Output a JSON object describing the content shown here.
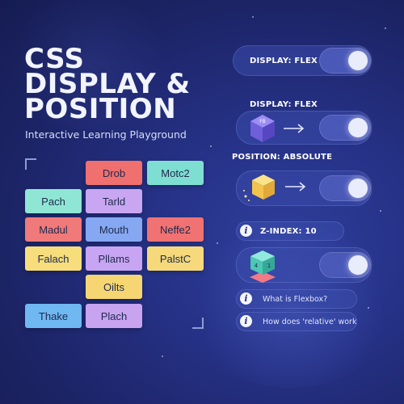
{
  "title_lines": [
    "CSS",
    "DISPLAY &",
    "POSITION"
  ],
  "subtitle": "Interactive Learning Playground",
  "blocks": [
    {
      "label": "Drob",
      "color": "#f06f6f"
    },
    {
      "label": "Motc2",
      "color": "#7fded2"
    },
    {
      "label": "Pach",
      "color": "#8fe6d4"
    },
    {
      "label": "Tarld",
      "color": "#c9a6f2"
    },
    {
      "label": "Madul",
      "color": "#f07a7a"
    },
    {
      "label": "Mouth",
      "color": "#86a8f2"
    },
    {
      "label": "Neffe2",
      "color": "#f07272"
    },
    {
      "label": "Falach",
      "color": "#f7dd7c"
    },
    {
      "label": "Pllams",
      "color": "#c7a5f2"
    },
    {
      "label": "PalstC",
      "color": "#f5d97a"
    },
    {
      "label": "Oilts",
      "color": "#f6d672"
    },
    {
      "label": "Thake",
      "color": "#6fb8f2"
    },
    {
      "label": "Plach",
      "color": "#c8a3f0"
    }
  ],
  "controls": {
    "display_flex_top": "DISPLAY: FLEX",
    "display_flex_label": "DISPLAY: FLEX",
    "cube_purple_label": "FB",
    "position_absolute_label": "POSITION: ABSOLUTE",
    "z_index_label": "Z-INDEX: 10",
    "cube_teal_labels": [
      "4",
      "1"
    ],
    "toggles": [
      {
        "name": "display-flex-top",
        "on": true
      },
      {
        "name": "display-flex",
        "on": true
      },
      {
        "name": "position-absolute",
        "on": true
      },
      {
        "name": "z-index",
        "on": true
      }
    ]
  },
  "help": {
    "info_glyph": "i",
    "q1": "What is Flexbox?",
    "q2": "How does 'relative' work"
  },
  "colors": {
    "background": "#1c2466",
    "pill": "#3a4aaa",
    "toggle_track": "#4a58b8",
    "knob": "#e9ecfb"
  }
}
